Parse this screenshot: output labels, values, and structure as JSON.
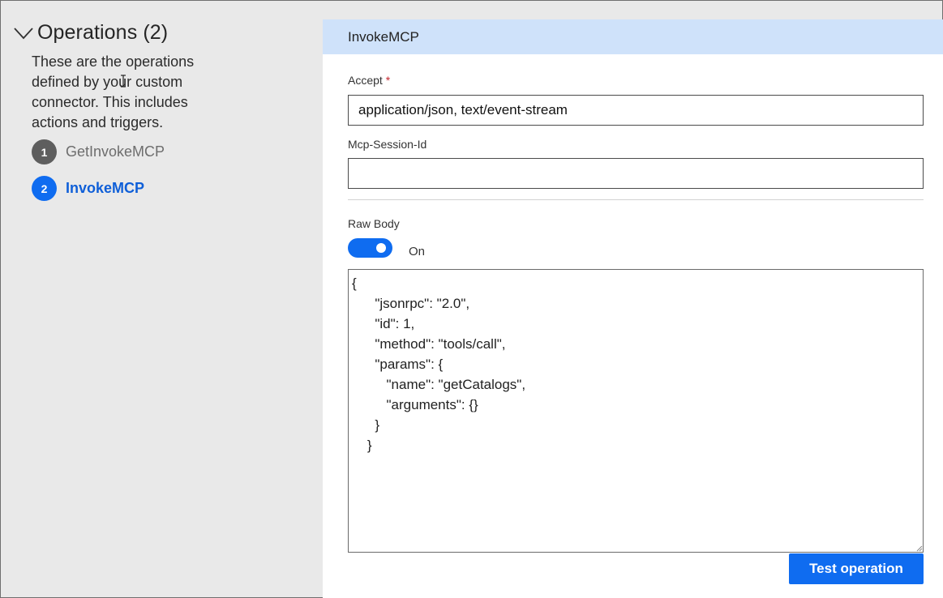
{
  "left": {
    "operations_title": "Operations (2)",
    "description": "These are the operations defined by your custom connector. This includes actions and triggers.",
    "operations": [
      {
        "number": "1",
        "label": "GetInvokeMCP"
      },
      {
        "number": "2",
        "label": "InvokeMCP"
      }
    ]
  },
  "right": {
    "title": "InvokeMCP",
    "accept": {
      "label": "Accept",
      "required_mark": "*",
      "value": "application/json, text/event-stream"
    },
    "session": {
      "label": "Mcp-Session-Id",
      "value": ""
    },
    "raw_body": {
      "label": "Raw Body",
      "toggle_state": "On",
      "content": "{\n      \"jsonrpc\": \"2.0\",\n      \"id\": 1,\n      \"method\": \"tools/call\",\n      \"params\": {\n         \"name\": \"getCatalogs\",\n         \"arguments\": {}\n      }\n    }"
    },
    "test_button": "Test operation"
  },
  "colors": {
    "accent": "#0f6cf0",
    "header_bg": "#cfe2fa",
    "left_bg": "#e9e9e9"
  }
}
